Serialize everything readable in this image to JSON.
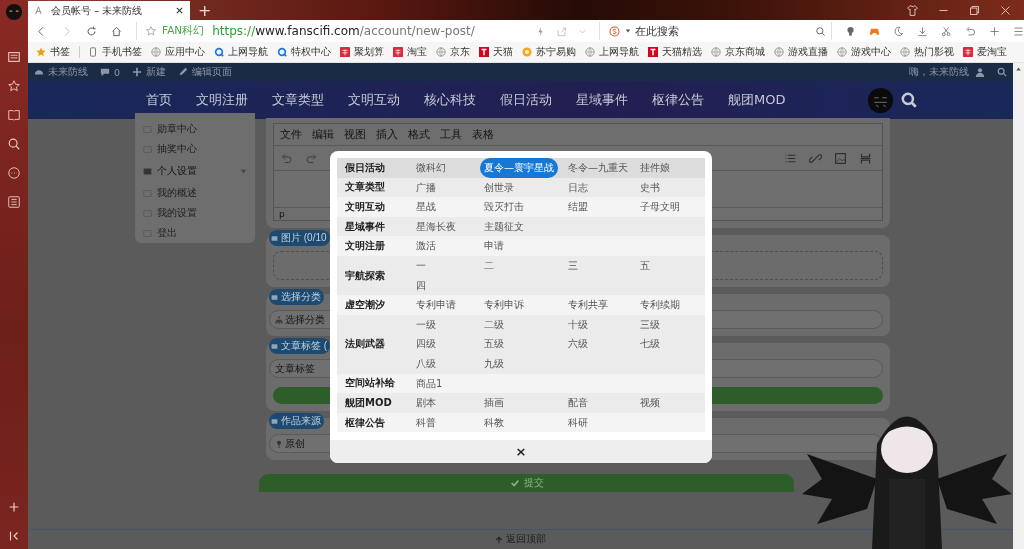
{
  "browser": {
    "tabs": [
      {
        "title": "会员帐号 – 未来防线",
        "selected": true
      }
    ],
    "new_tab": "+",
    "address": {
      "site_label": "FAN科幻",
      "scheme": "https://",
      "host": "www.fanscifi.com",
      "path": "/account/new-post/"
    },
    "search": {
      "placeholder": "在此搜索"
    },
    "bookmarks": [
      {
        "kind": "star",
        "label": "书签"
      },
      {
        "kind": "phone",
        "label": "手机书签"
      },
      {
        "kind": "globe",
        "label": "应用中心"
      },
      {
        "kind": "q",
        "label": "上网导航"
      },
      {
        "kind": "q",
        "label": "特权中心"
      },
      {
        "kind": "red",
        "label": "聚划算"
      },
      {
        "kind": "red",
        "label": "淘宝"
      },
      {
        "kind": "globe",
        "label": "京东"
      },
      {
        "kind": "tmall",
        "label": "天猫"
      },
      {
        "kind": "orange",
        "label": "苏宁易购"
      },
      {
        "kind": "globe",
        "label": "上网导航"
      },
      {
        "kind": "tmall",
        "label": "天猫精选"
      },
      {
        "kind": "globe",
        "label": "京东商城"
      },
      {
        "kind": "globe",
        "label": "游戏直播"
      },
      {
        "kind": "globe",
        "label": "游戏中心"
      },
      {
        "kind": "globe",
        "label": "热门影视"
      },
      {
        "kind": "red",
        "label": "爱淘宝"
      }
    ]
  },
  "admin_bar": {
    "site": "未来防线",
    "comments": "0",
    "new": "新建",
    "edit": "编辑页面",
    "greeting": "嗨，未来防线"
  },
  "nav": [
    "首页",
    "文明注册",
    "文章类型",
    "文明互动",
    "核心科技",
    "假日活动",
    "星域事件",
    "枢律公告",
    "舰团MOD"
  ],
  "sidebar": [
    {
      "kind": "link",
      "label": "勋章中心"
    },
    {
      "kind": "link",
      "label": "抽奖中心"
    },
    {
      "kind": "group",
      "label": "个人设置",
      "expanded": true
    },
    {
      "kind": "link",
      "label": "我的概述"
    },
    {
      "kind": "link",
      "label": "我的设置"
    },
    {
      "kind": "link",
      "label": "登出"
    }
  ],
  "editor": {
    "menu": [
      "文件",
      "编辑",
      "视图",
      "插入",
      "格式",
      "工具",
      "表格"
    ],
    "status": "p"
  },
  "sections": [
    {
      "kind": "images",
      "label": "图片 (0/10"
    },
    {
      "kind": "category",
      "label": "选择分类",
      "field": "选择分类"
    },
    {
      "kind": "tags",
      "label": "文章标签 (",
      "placeholder": "文章标签"
    },
    {
      "kind": "source",
      "label": "作品来源",
      "value": "原创"
    }
  ],
  "submit": "提交",
  "back_to_top": "返回顶部",
  "modal": {
    "close": "×",
    "rows": [
      {
        "label": "假日活动",
        "items": [
          {
            "text": "微科幻",
            "selected": false
          },
          {
            "text": "夏令—寰宇星战",
            "selected": true
          },
          {
            "text": "冬令—九重天",
            "selected": false
          },
          {
            "text": "挂件娘",
            "selected": false
          }
        ]
      },
      {
        "label": "文章类型",
        "items": [
          {
            "text": "广播",
            "selected": false
          },
          {
            "text": "创世录",
            "selected": false
          },
          {
            "text": "日志",
            "selected": false
          },
          {
            "text": "史书",
            "selected": false
          }
        ]
      },
      {
        "label": "文明互动",
        "items": [
          {
            "text": "星战",
            "selected": false
          },
          {
            "text": "毁灭打击",
            "selected": false
          },
          {
            "text": "结盟",
            "selected": false
          },
          {
            "text": "子母文明",
            "selected": false
          }
        ]
      },
      {
        "label": "星域事件",
        "items": [
          {
            "text": "星海长夜",
            "selected": false
          },
          {
            "text": "主题征文",
            "selected": false
          }
        ]
      },
      {
        "label": "文明注册",
        "items": [
          {
            "text": "激活",
            "selected": false
          },
          {
            "text": "申请",
            "selected": false
          }
        ]
      },
      {
        "label": "宇航探索",
        "items": [
          {
            "text": "一",
            "selected": false
          },
          {
            "text": "二",
            "selected": false
          },
          {
            "text": "三",
            "selected": false
          },
          {
            "text": "五",
            "selected": false
          },
          {
            "text": "四",
            "selected": false
          }
        ]
      },
      {
        "label": "虚空潮汐",
        "items": [
          {
            "text": "专利申请",
            "selected": false
          },
          {
            "text": "专利申诉",
            "selected": false
          },
          {
            "text": "专利共享",
            "selected": false
          },
          {
            "text": "专利续期",
            "selected": false
          }
        ]
      },
      {
        "label": "法则武器",
        "items": [
          {
            "text": "一级",
            "selected": false
          },
          {
            "text": "二级",
            "selected": false
          },
          {
            "text": "十级",
            "selected": false
          },
          {
            "text": "三级",
            "selected": false
          },
          {
            "text": "四级",
            "selected": false
          },
          {
            "text": "五级",
            "selected": false
          },
          {
            "text": "六级",
            "selected": false
          },
          {
            "text": "七级",
            "selected": false
          },
          {
            "text": "八级",
            "selected": false
          },
          {
            "text": "九级",
            "selected": false
          }
        ]
      },
      {
        "label": "空间站补给",
        "items": [
          {
            "text": "商品1",
            "selected": false
          }
        ]
      },
      {
        "label": "舰团MOD",
        "items": [
          {
            "text": "剧本",
            "selected": false
          },
          {
            "text": "插画",
            "selected": false
          },
          {
            "text": "配音",
            "selected": false
          },
          {
            "text": "视频",
            "selected": false
          }
        ]
      },
      {
        "label": "枢律公告",
        "items": [
          {
            "text": "科普",
            "selected": false
          },
          {
            "text": "科教",
            "selected": false
          },
          {
            "text": "科研",
            "selected": false
          }
        ]
      }
    ]
  }
}
